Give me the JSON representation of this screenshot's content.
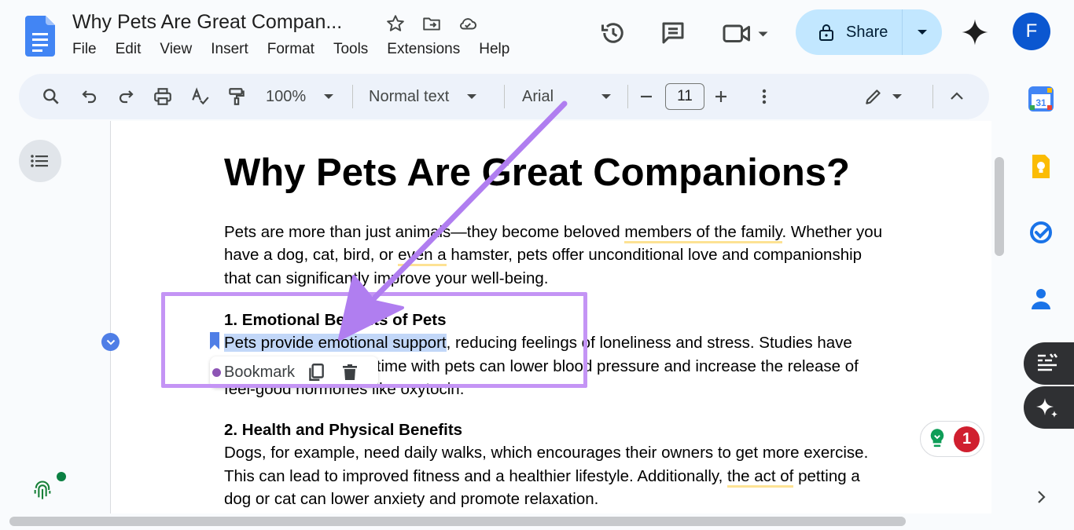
{
  "header": {
    "doc_title": "Why Pets Are Great Compan...",
    "menu": [
      "File",
      "Edit",
      "View",
      "Insert",
      "Format",
      "Tools",
      "Extensions",
      "Help"
    ],
    "share_label": "Share",
    "avatar_initial": "F"
  },
  "toolbar": {
    "zoom": "100%",
    "style": "Normal text",
    "font": "Arial",
    "font_size": "11"
  },
  "document": {
    "title": "Why Pets Are Great Companions?",
    "intro": {
      "l1a": "Pets are more than just animals—they become beloved ",
      "l1b": "members of the family",
      "l1c": ". Whether you",
      "l2a": "have a dog, cat, bird, or ",
      "l2b": "even a",
      "l2c": " hamster, pets offer unconditional love and companionship",
      "l3": "that can significantly improve your well-being."
    },
    "section1": {
      "heading": "1. Emotional Benefits of Pets",
      "l1a": "Pets provide emotional support",
      "l1b": ", reducing feelings of loneliness and stress. Studies have",
      "l2": "shown that spending time with pets can lower blood pressure and increase the release of",
      "l3": "feel-good hormones like oxytocin."
    },
    "section2": {
      "heading": "2. Health and Physical Benefits",
      "l1": "Dogs, for example, need daily walks, which encourages their owners to get more exercise.",
      "l2a": "This can lead to improved fitness and a healthier lifestyle. Additionally, ",
      "l2b": "the act of",
      "l2c": " petting a",
      "l3": "dog or cat can lower anxiety and promote relaxation."
    }
  },
  "bookmark_popup": {
    "label": "Bookmark"
  },
  "grammar_badge": {
    "count": "1"
  },
  "side_panel": {
    "calendar_day": "31"
  },
  "colors": {
    "accent_blue": "#0b57d0",
    "share_bg": "#c2e7ff",
    "annotation_purple": "#c494f5",
    "highlight": "#c2d7f8",
    "suggestion_underline": "#fde293"
  }
}
